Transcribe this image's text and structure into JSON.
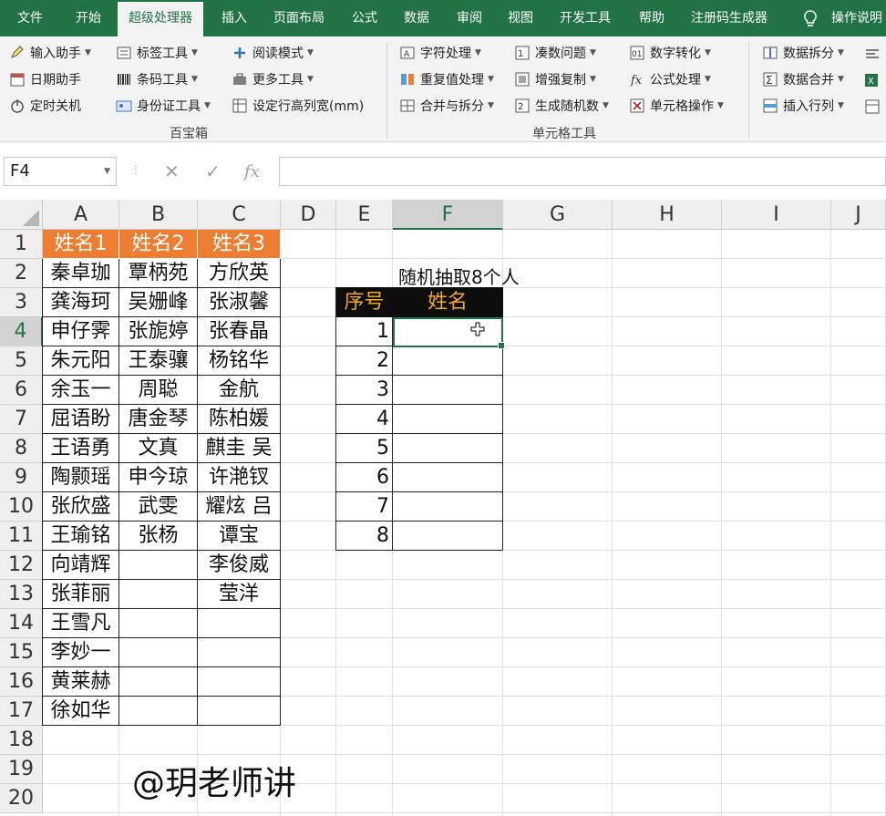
{
  "ribbon_tabs": [
    "文件",
    "开始",
    "超级处理器",
    "插入",
    "页面布局",
    "公式",
    "数据",
    "审阅",
    "视图",
    "开发工具",
    "帮助",
    "注册码生成器",
    "操作说明"
  ],
  "active_tab": "超级处理器",
  "ribbon": {
    "groups": [
      "百宝箱",
      "单元格工具"
    ],
    "buttons": {
      "input_helper": "输入助手",
      "label_tool": "标签工具",
      "reading_mode": "阅读模式",
      "char_process": "字符处理",
      "sum_problem": "凑数问题",
      "digit_convert": "数字转化",
      "data_split": "数据拆分",
      "date_helper": "日期助手",
      "barcode_tool": "条码工具",
      "more_tools": "更多工具",
      "dup_process": "重复值处理",
      "enhanced_copy": "增强复制",
      "formula_process": "公式处理",
      "data_merge": "数据合并",
      "timed_shutdown": "定时关机",
      "id_tool": "身份证工具",
      "set_row_col": "设定行高列宽(mm)",
      "merge_split": "合并与拆分",
      "gen_random": "生成随机数",
      "cell_ops": "单元格操作",
      "insert_rowcol": "插入行列"
    }
  },
  "formula_bar": {
    "name_box": "F4",
    "formula": ""
  },
  "columns": [
    "A",
    "B",
    "C",
    "D",
    "E",
    "F",
    "G",
    "H",
    "I",
    "J"
  ],
  "selected_column": "F",
  "rows": [
    "1",
    "2",
    "3",
    "4",
    "5",
    "6",
    "7",
    "8",
    "9",
    "10",
    "11",
    "12",
    "13",
    "14",
    "15",
    "16",
    "17",
    "18",
    "19",
    "20"
  ],
  "selected_row": "4",
  "names_table": {
    "headers": [
      "姓名1",
      "姓名2",
      "姓名3"
    ],
    "rows": [
      [
        "秦卓珈",
        "覃柄苑",
        "方欣英"
      ],
      [
        "龚海珂",
        "吴姗峰",
        "张淑馨"
      ],
      [
        "申仔霁",
        "张旎婷",
        "张春晶"
      ],
      [
        "朱元阳",
        "王泰骧",
        "杨铭华"
      ],
      [
        "余玉一",
        "周聪",
        "金航"
      ],
      [
        "屈语盼",
        "唐金琴",
        "陈柏媛"
      ],
      [
        "王语勇",
        "文真",
        "麒圭 吴"
      ],
      [
        "陶颢瑶",
        "申今琼",
        "许滟钗"
      ],
      [
        "张欣盛",
        "武雯",
        "耀炫 吕"
      ],
      [
        "王瑜铭",
        "张杨",
        "谭宝"
      ],
      [
        "向靖辉",
        "",
        "李俊威"
      ],
      [
        "张菲丽",
        "",
        "莹洋"
      ],
      [
        "王雪凡",
        "",
        ""
      ],
      [
        "李妙一",
        "",
        ""
      ],
      [
        "黄莱赫",
        "",
        ""
      ],
      [
        "徐如华",
        "",
        ""
      ]
    ]
  },
  "caption": "随机抽取8个人",
  "result_table": {
    "headers": [
      "序号",
      "姓名"
    ],
    "numbers": [
      "1",
      "2",
      "3",
      "4",
      "5",
      "6",
      "7",
      "8"
    ],
    "names": [
      "",
      "",
      "",
      "",
      "",
      "",
      "",
      ""
    ]
  },
  "watermark": "@玥老师讲"
}
